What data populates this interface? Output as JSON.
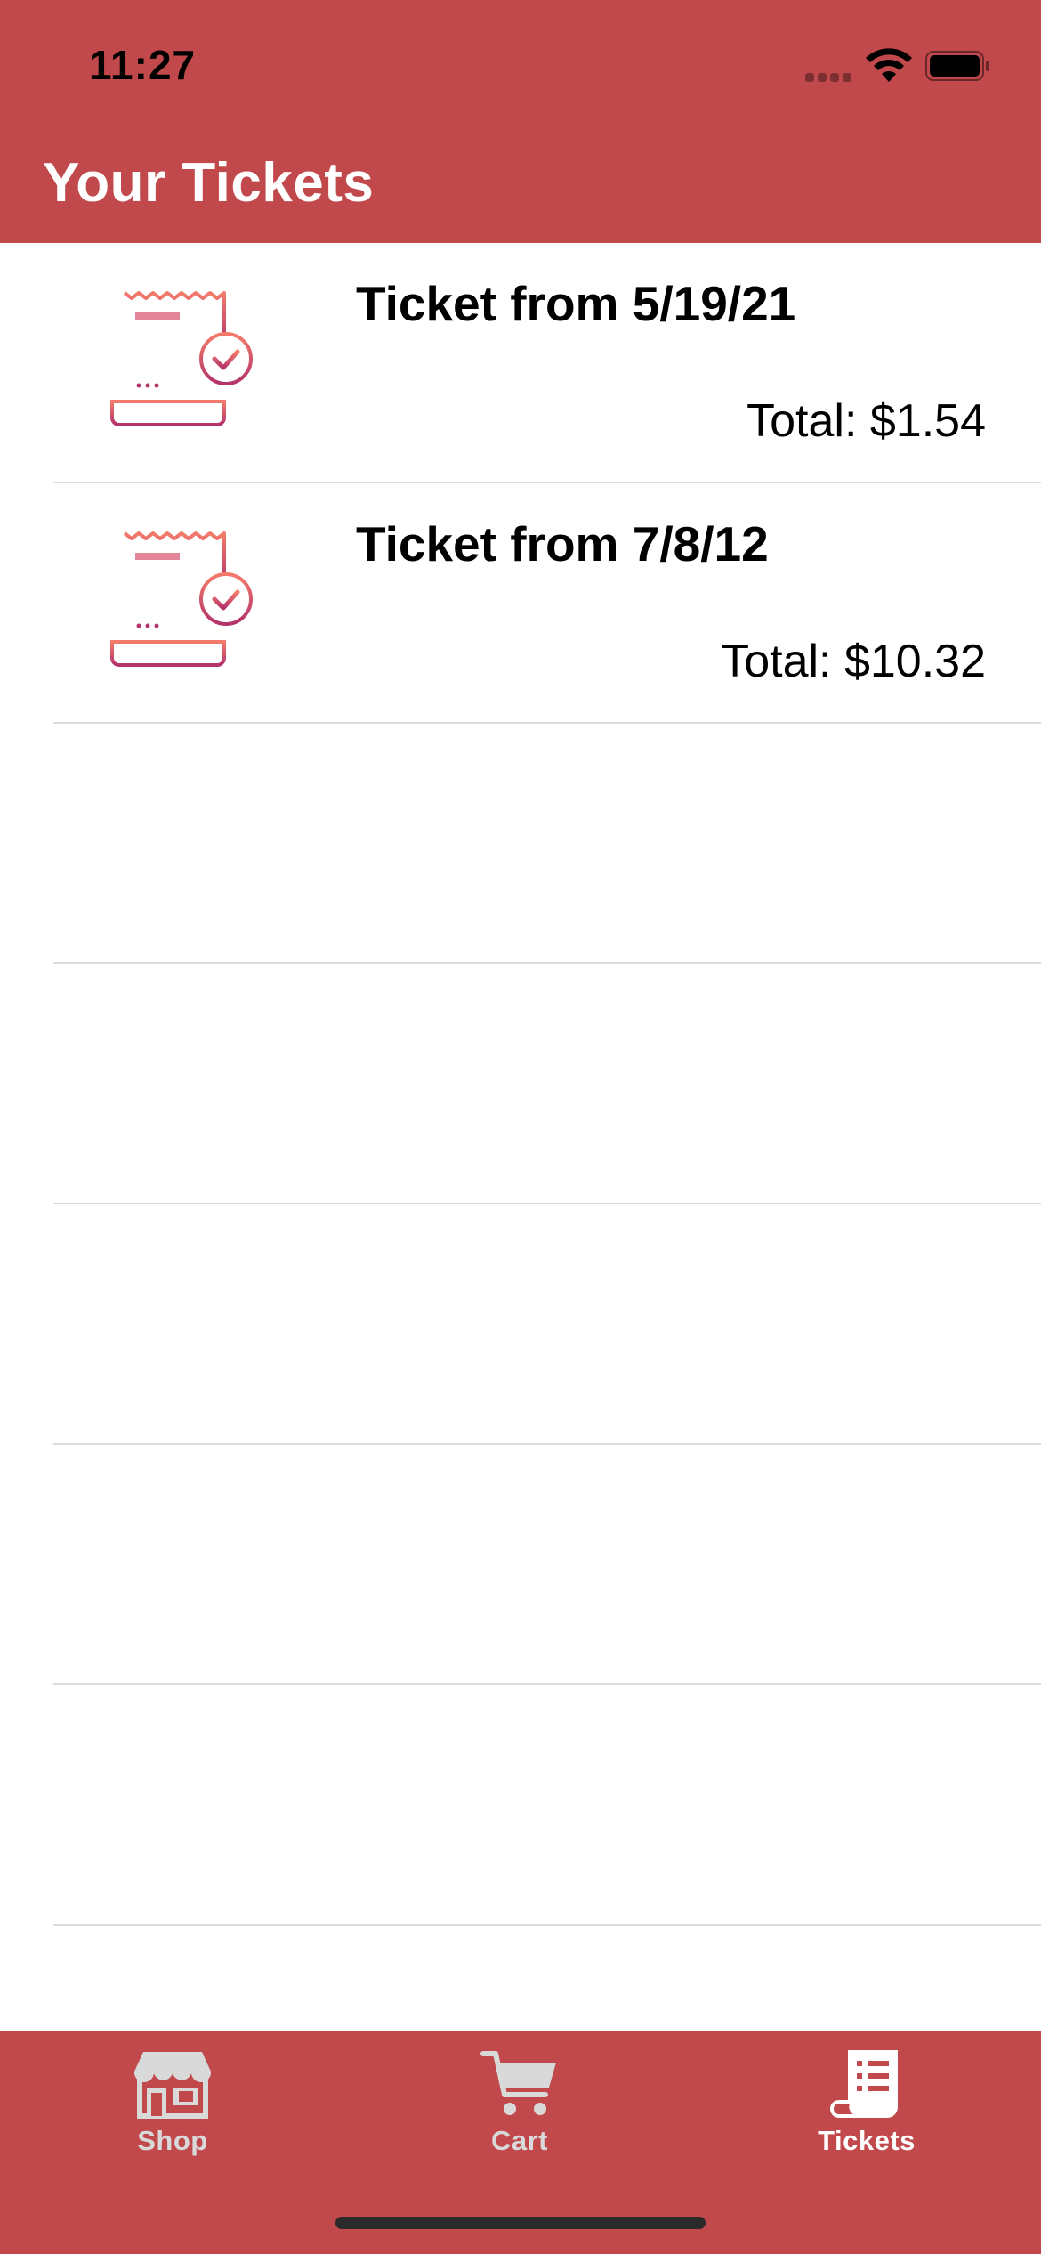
{
  "status_bar": {
    "time": "11:27"
  },
  "header": {
    "title": "Your Tickets",
    "background_color": "#c1484b"
  },
  "tickets": [
    {
      "title": "Ticket from 5/19/21",
      "total": "Total: $1.54",
      "icon": "receipt-check-icon"
    },
    {
      "title": "Ticket from 7/8/12",
      "total": "Total: $10.32",
      "icon": "receipt-check-icon"
    }
  ],
  "tab_bar": {
    "tabs": [
      {
        "label": "Shop",
        "icon": "storefront-icon",
        "active": false
      },
      {
        "label": "Cart",
        "icon": "cart-icon",
        "active": false
      },
      {
        "label": "Tickets",
        "icon": "receipt-icon",
        "active": true
      }
    ]
  },
  "colors": {
    "accent": "#c1484b",
    "icon_gradient_top": "#f47b6b",
    "icon_gradient_bottom": "#b3336a",
    "tab_active": "#ffffff",
    "tab_inactive": "#d9d9d9"
  }
}
